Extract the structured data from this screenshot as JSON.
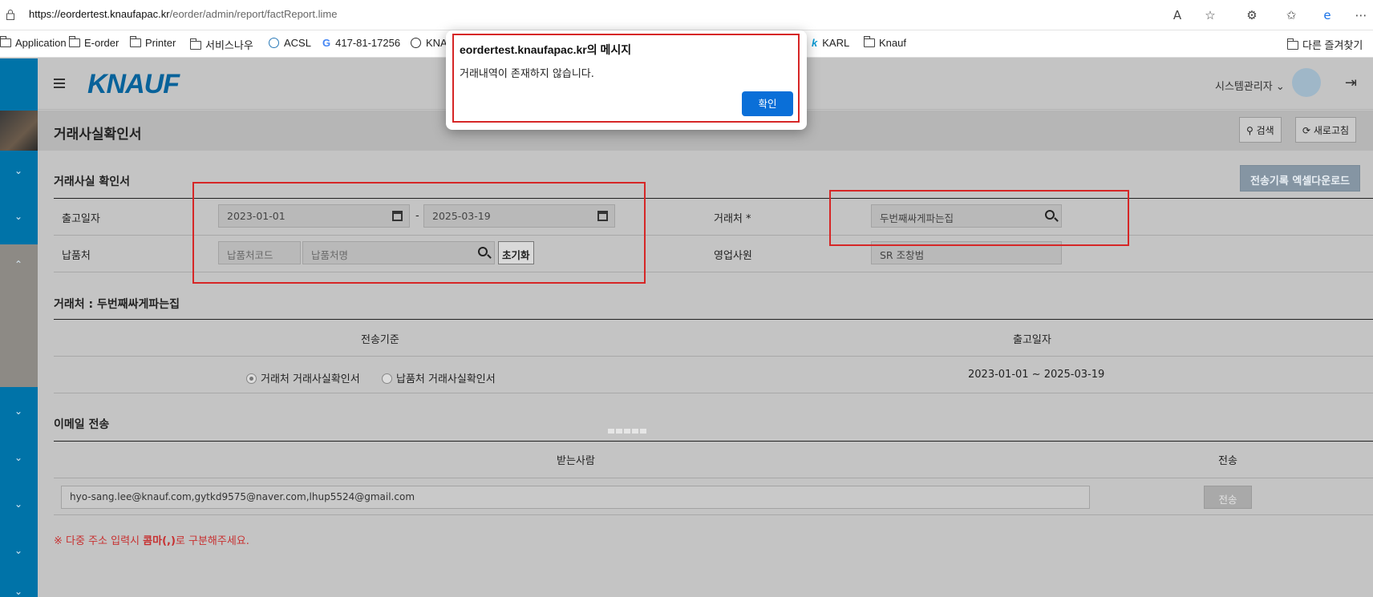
{
  "browser": {
    "url_host": "https://eordertest.knaufapac.kr",
    "url_path": "/eorder/admin/report/factReport.lime",
    "bookmarks": [
      "Application",
      "E-order",
      "Printer",
      "서비스나우",
      "ACSL",
      "417-81-17256",
      "KNA",
      "KARL",
      "Knauf"
    ],
    "other_bookmarks": "다른 즐겨찾기"
  },
  "app": {
    "logo": "KNAUF",
    "user": "시스템관리자",
    "page_title": "거래사실확인서",
    "search_button": "검색",
    "refresh_button": "새로고침"
  },
  "form": {
    "section_title": "거래사실 확인서",
    "excel_button": "전송기록 엑셀다운로드",
    "ship_date_label": "출고일자",
    "date_from": "2023-01-01",
    "date_sep": "-",
    "date_to": "2025-03-19",
    "customer_label": "거래처 *",
    "customer_value": "두번째싸게파는집",
    "delivery_label": "납품처",
    "delivery_code_placeholder": "납품처코드",
    "delivery_name_placeholder": "납품처명",
    "reset_button": "초기화",
    "sales_label": "영업사원",
    "sales_value": "SR 조창범"
  },
  "summary": {
    "title": "거래처 : 두번째싸게파는집",
    "col_basis": "전송기준",
    "col_date": "출고일자",
    "radio_customer": "거래처 거래사실확인서",
    "radio_delivery": "납품처 거래사실확인서",
    "date_range": "2023-01-01 ~ 2025-03-19"
  },
  "email": {
    "title": "이메일 전송",
    "col_recipient": "받는사람",
    "col_send": "전송",
    "recipients": "hyo-sang.lee@knauf.com,gytkd9575@naver.com,lhup5524@gmail.com",
    "send_button": "전송",
    "note_prefix": "※ 다중 주소 입력시 ",
    "note_bold": "콤마(,)",
    "note_suffix": "로 구분해주세요."
  },
  "dialog": {
    "title": "eordertest.knaufapac.kr의 메시지",
    "message": "거래내역이 존재하지 않습니다.",
    "ok_button": "확인"
  }
}
